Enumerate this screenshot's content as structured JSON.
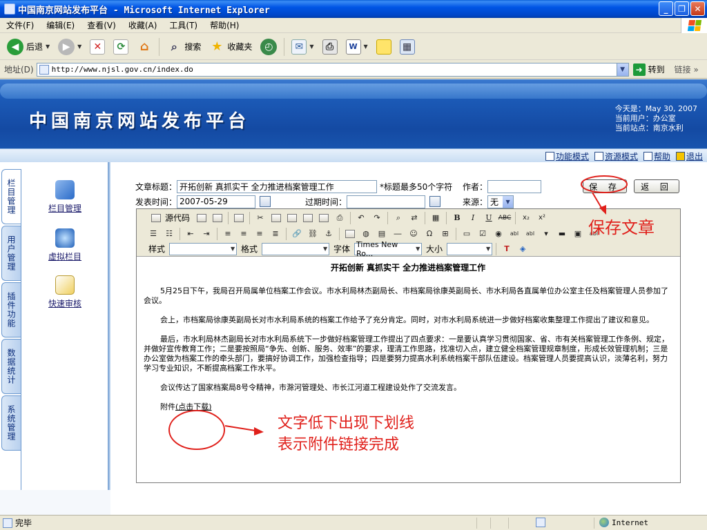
{
  "window": {
    "title": "中国南京网站发布平台 - Microsoft Internet Explorer",
    "minimize": "_",
    "maximize": "❐",
    "close": "✕"
  },
  "menu": [
    "文件(F)",
    "编辑(E)",
    "查看(V)",
    "收藏(A)",
    "工具(T)",
    "帮助(H)"
  ],
  "toolbar": {
    "back": "后退",
    "search": "搜索",
    "favorites": "收藏夹"
  },
  "address": {
    "label": "地址(D)",
    "url": "http://www.njsl.gov.cn/index.do",
    "go": "转到",
    "links": "链接"
  },
  "site": {
    "title": "中国南京网站发布平台",
    "today": "今天是：May 30, 2007",
    "current_user": "当前用户：办公室",
    "current_site": "当前站点：南京水利"
  },
  "nav": [
    "功能模式",
    "资源模式",
    "帮助",
    "退出"
  ],
  "vtabs": [
    "栏目管理",
    "用户管理",
    "插件功能",
    "数据统计",
    "系统管理"
  ],
  "left_items": [
    "栏目管理",
    "虚拟栏目",
    "快速审核"
  ],
  "form": {
    "title_label": "文章标题：",
    "title_value": "开拓创新 真抓实干 全力推进档案管理工作",
    "title_hint": "*标题最多50个字符",
    "author_label": "作者：",
    "author_value": "",
    "publish_label": "发表时间：",
    "publish_value": "2007-05-29",
    "expire_label": "过期时间：",
    "expire_value": "",
    "source_label": "来源：",
    "source_value": "无",
    "save": "保 存",
    "back": "返 回"
  },
  "editor": {
    "source_code": "源代码",
    "style_label": "样式",
    "format_label": "格式",
    "font_label": "字体",
    "font_value": "Times New Ro...",
    "size_label": "大小"
  },
  "document": {
    "title": "开拓创新 真抓实干 全力推进档案管理工作",
    "paragraphs": [
      "5月25日下午，我局召开局属单位档案工作会议。市水利局林杰副局长、市档案局徐康英副局长、市水利局各直属单位办公室主任及档案管理人员参加了会议。",
      "会上，市档案局徐康英副局长对市水利局系统的档案工作给予了充分肯定。同时，对市水利局系统进一步做好档案收集整理工作提出了建议和意见。",
      "最后，市水利局林杰副局长对市水利局系统下一步做好档案管理工作提出了四点要求：一是要认真学习贯彻国家、省、市有关档案管理工作条例、规定，并做好宣传教育工作；二是要按照局“争先、创新、服务、效率”的要求，理清工作思路，找准切入点，建立健全档案管理规章制度，形成长效管理机制；三是办公室做为档案工作的牵头部门，要搞好协调工作，加强检查指导；四是要努力提高水利系统档案干部队伍建设。档案管理人员要提高认识，淡薄名利，努力学习专业知识，不断提高档案工作水平。",
      "会议传达了国家档案局8号令精神，市滁河管理处、市长江河道工程建设处作了交流发言。"
    ],
    "attach_prefix": "附件",
    "attach_link": "(点击下载)"
  },
  "annotations": {
    "save_note": "保存文章",
    "link_note_line1": "文字低下出现下划线",
    "link_note_line2": "表示附件链接完成"
  },
  "status": {
    "text": "完毕",
    "zone": "Internet"
  },
  "colors": {
    "annotation": "#e0201b",
    "banner": "#1c5bb8",
    "titlebar": "#0055e5"
  }
}
